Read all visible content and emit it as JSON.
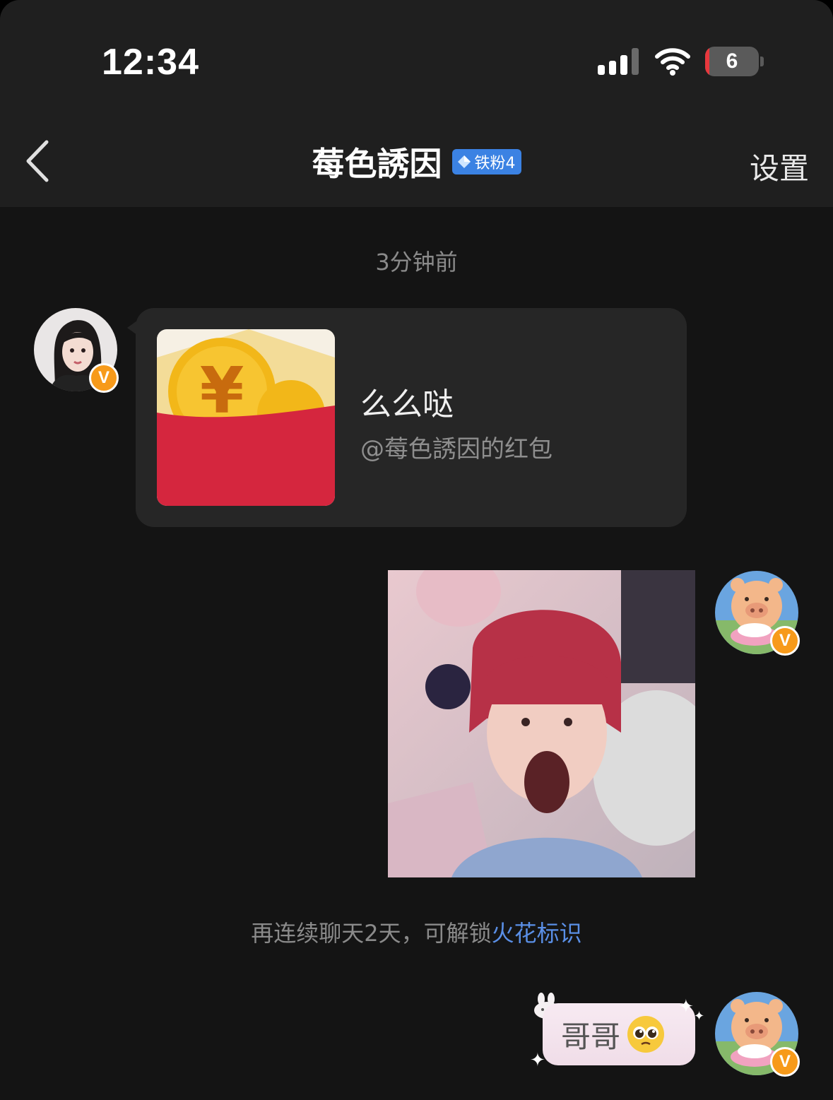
{
  "status_bar": {
    "time": "12:34",
    "battery_level": "6",
    "battery_fraction": 0.06,
    "battery_color": "#e8383d"
  },
  "nav": {
    "back_icon": "chevron-left-icon",
    "title": "莓色誘因",
    "fan_badge": "铁粉4",
    "fan_badge_color": "#3b82e3",
    "settings": "设置"
  },
  "chat": {
    "timestamp": "3分钟前",
    "red_packet": {
      "title": "么么哒",
      "subtitle": "@莓色誘因的红包"
    },
    "system": {
      "text": "再连续聊天2天，可解锁",
      "link": "火花标识",
      "link_color": "#5a8fe6"
    },
    "sticker": {
      "text": "哥哥",
      "emoji_icon": "pleading-face-icon"
    }
  }
}
